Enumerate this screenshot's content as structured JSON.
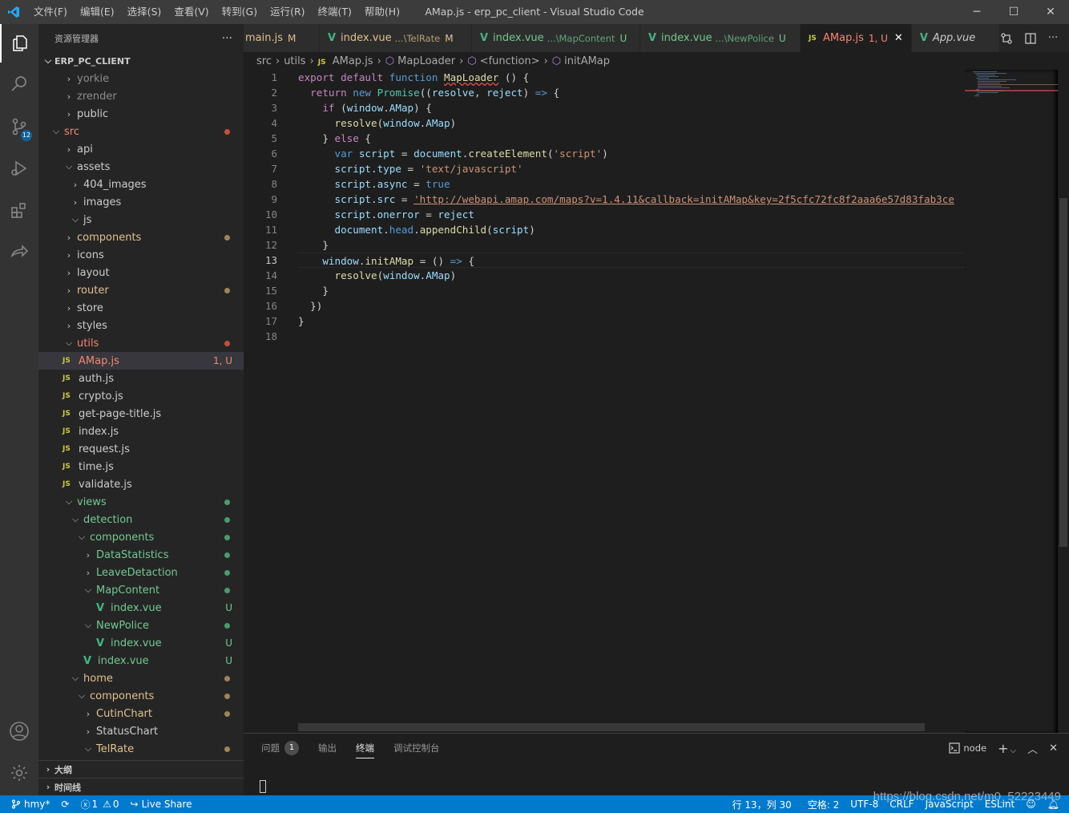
{
  "titlebar": {
    "menu": [
      "文件(F)",
      "编辑(E)",
      "选择(S)",
      "查看(V)",
      "转到(G)",
      "运行(R)",
      "终端(T)",
      "帮助(H)"
    ],
    "title": "AMap.js - erp_pc_client - Visual Studio Code",
    "minimize": "─",
    "maximize": "☐",
    "close": "✕"
  },
  "activity": {
    "scm_badge": "12"
  },
  "sidebar": {
    "title": "资源管理器",
    "more": "···",
    "root": "ERP_PC_CLIENT",
    "items": [
      {
        "label": "yorkie",
        "indent": 1,
        "type": "folder",
        "open": false,
        "color": "ignored"
      },
      {
        "label": "zrender",
        "indent": 1,
        "type": "folder",
        "open": false,
        "color": "ignored"
      },
      {
        "label": "public",
        "indent": 1,
        "type": "folder",
        "open": false,
        "color": "normal"
      },
      {
        "label": "src",
        "indent": 0,
        "type": "folder",
        "open": true,
        "color": "err",
        "dot": "err"
      },
      {
        "label": "api",
        "indent": 1,
        "type": "folder",
        "open": false,
        "color": "normal"
      },
      {
        "label": "assets",
        "indent": 1,
        "type": "folder",
        "open": true,
        "color": "normal"
      },
      {
        "label": "404_images",
        "indent": 2,
        "type": "folder",
        "open": false,
        "color": "normal"
      },
      {
        "label": "images",
        "indent": 2,
        "type": "folder",
        "open": false,
        "color": "normal"
      },
      {
        "label": "js",
        "indent": 2,
        "type": "folder",
        "open": true,
        "color": "normal"
      },
      {
        "label": "components",
        "indent": 1,
        "type": "folder",
        "open": false,
        "color": "mod",
        "dot": "mod"
      },
      {
        "label": "icons",
        "indent": 1,
        "type": "folder",
        "open": false,
        "color": "normal"
      },
      {
        "label": "layout",
        "indent": 1,
        "type": "folder",
        "open": false,
        "color": "normal"
      },
      {
        "label": "router",
        "indent": 1,
        "type": "folder",
        "open": false,
        "color": "mod",
        "dot": "mod"
      },
      {
        "label": "store",
        "indent": 1,
        "type": "folder",
        "open": false,
        "color": "normal"
      },
      {
        "label": "styles",
        "indent": 1,
        "type": "folder",
        "open": false,
        "color": "normal"
      },
      {
        "label": "utils",
        "indent": 1,
        "type": "folder",
        "open": true,
        "color": "err",
        "dot": "err"
      },
      {
        "label": "AMap.js",
        "indent": 1,
        "type": "js",
        "color": "err",
        "deco": "1, U",
        "selected": true
      },
      {
        "label": "auth.js",
        "indent": 1,
        "type": "js",
        "color": "normal"
      },
      {
        "label": "crypto.js",
        "indent": 1,
        "type": "js",
        "color": "normal"
      },
      {
        "label": "get-page-title.js",
        "indent": 1,
        "type": "js",
        "color": "normal"
      },
      {
        "label": "index.js",
        "indent": 1,
        "type": "js",
        "color": "normal"
      },
      {
        "label": "request.js",
        "indent": 1,
        "type": "js",
        "color": "normal"
      },
      {
        "label": "time.js",
        "indent": 1,
        "type": "js",
        "color": "normal"
      },
      {
        "label": "validate.js",
        "indent": 1,
        "type": "js",
        "color": "normal"
      },
      {
        "label": "views",
        "indent": 1,
        "type": "folder",
        "open": true,
        "color": "untracked",
        "dot": "untracked"
      },
      {
        "label": "detection",
        "indent": 2,
        "type": "folder",
        "open": true,
        "color": "untracked",
        "dot": "untracked"
      },
      {
        "label": "components",
        "indent": 3,
        "type": "folder",
        "open": true,
        "color": "untracked",
        "dot": "untracked"
      },
      {
        "label": "DataStatistics",
        "indent": 4,
        "type": "folder",
        "open": false,
        "color": "untracked",
        "dot": "untracked"
      },
      {
        "label": "LeaveDetaction",
        "indent": 4,
        "type": "folder",
        "open": false,
        "color": "untracked",
        "dot": "untracked"
      },
      {
        "label": "MapContent",
        "indent": 4,
        "type": "folder",
        "open": true,
        "color": "untracked",
        "dot": "untracked"
      },
      {
        "label": "index.vue",
        "indent": 5,
        "type": "vue",
        "color": "untracked",
        "deco": "U"
      },
      {
        "label": "NewPolice",
        "indent": 4,
        "type": "folder",
        "open": true,
        "color": "untracked",
        "dot": "untracked"
      },
      {
        "label": "index.vue",
        "indent": 5,
        "type": "vue",
        "color": "untracked",
        "deco": "U"
      },
      {
        "label": "index.vue",
        "indent": 3,
        "type": "vue",
        "color": "untracked",
        "deco": "U"
      },
      {
        "label": "home",
        "indent": 2,
        "type": "folder",
        "open": true,
        "color": "mod",
        "dot": "mod"
      },
      {
        "label": "components",
        "indent": 3,
        "type": "folder",
        "open": true,
        "color": "mod",
        "dot": "mod"
      },
      {
        "label": "CutinChart",
        "indent": 4,
        "type": "folder",
        "open": false,
        "color": "mod",
        "dot": "mod"
      },
      {
        "label": "StatusChart",
        "indent": 4,
        "type": "folder",
        "open": false,
        "color": "normal"
      },
      {
        "label": "TelRate",
        "indent": 4,
        "type": "folder",
        "open": true,
        "color": "mod",
        "dot": "mod"
      }
    ],
    "outline": "大纲",
    "timeline": "时间线"
  },
  "tabs": [
    {
      "label": "main.js",
      "desc": "",
      "status": "M",
      "icon": "none",
      "color": "mod"
    },
    {
      "label": "index.vue",
      "desc": "...\\TelRate",
      "status": "M",
      "icon": "vue",
      "color": "mod"
    },
    {
      "label": "index.vue",
      "desc": "...\\MapContent",
      "status": "U",
      "icon": "vue",
      "color": "untracked"
    },
    {
      "label": "index.vue",
      "desc": "...\\NewPolice",
      "status": "U",
      "icon": "vue",
      "color": "untracked"
    },
    {
      "label": "AMap.js",
      "desc": "",
      "status": "1, U",
      "icon": "js",
      "color": "err",
      "active": true,
      "close": "✕"
    },
    {
      "label": "App.vue",
      "desc": "",
      "status": "",
      "icon": "vue",
      "color": "normal",
      "italic": true
    }
  ],
  "tab_actions": {
    "more": "···"
  },
  "breadcrumb": [
    "src",
    "utils",
    "AMap.js",
    "MapLoader",
    "<function>",
    "initAMap"
  ],
  "editor": {
    "current_line": 13,
    "lines": [
      [
        [
          "kc",
          "export"
        ],
        [
          "t",
          " "
        ],
        [
          "kc",
          "default"
        ],
        [
          "t",
          " "
        ],
        [
          "kw",
          "function"
        ],
        [
          "t",
          " "
        ],
        [
          "fn",
          "MapLoader"
        ],
        [
          "t",
          " () {"
        ]
      ],
      [
        [
          "t",
          "  "
        ],
        [
          "kc",
          "return"
        ],
        [
          "t",
          " "
        ],
        [
          "kw",
          "new"
        ],
        [
          "t",
          " "
        ],
        [
          "cls",
          "Promise"
        ],
        [
          "t",
          "(("
        ],
        [
          "vr",
          "resolve"
        ],
        [
          "t",
          ", "
        ],
        [
          "vr",
          "reject"
        ],
        [
          "t",
          ") "
        ],
        [
          "kw",
          "=>"
        ],
        [
          "t",
          " {"
        ]
      ],
      [
        [
          "t",
          "    "
        ],
        [
          "kc",
          "if"
        ],
        [
          "t",
          " ("
        ],
        [
          "vr",
          "window"
        ],
        [
          "t",
          "."
        ],
        [
          "vr",
          "AMap"
        ],
        [
          "t",
          ") {"
        ]
      ],
      [
        [
          "t",
          "      "
        ],
        [
          "fn",
          "resolve"
        ],
        [
          "t",
          "("
        ],
        [
          "vr",
          "window"
        ],
        [
          "t",
          "."
        ],
        [
          "vr",
          "AMap"
        ],
        [
          "t",
          ")"
        ]
      ],
      [
        [
          "t",
          "    } "
        ],
        [
          "kc",
          "else"
        ],
        [
          "t",
          " {"
        ]
      ],
      [
        [
          "t",
          "      "
        ],
        [
          "kw",
          "var"
        ],
        [
          "t",
          " "
        ],
        [
          "vr",
          "script"
        ],
        [
          "t",
          " = "
        ],
        [
          "vr",
          "document"
        ],
        [
          "t",
          "."
        ],
        [
          "fn",
          "createElement"
        ],
        [
          "t",
          "("
        ],
        [
          "st",
          "'script'"
        ],
        [
          "t",
          ")"
        ]
      ],
      [
        [
          "t",
          "      "
        ],
        [
          "vr",
          "script"
        ],
        [
          "t",
          "."
        ],
        [
          "vr",
          "type"
        ],
        [
          "t",
          " = "
        ],
        [
          "st",
          "'text/javascript'"
        ]
      ],
      [
        [
          "t",
          "      "
        ],
        [
          "vr",
          "script"
        ],
        [
          "t",
          "."
        ],
        [
          "vr",
          "async"
        ],
        [
          "t",
          " = "
        ],
        [
          "kw",
          "true"
        ]
      ],
      [
        [
          "t",
          "      "
        ],
        [
          "vr",
          "script"
        ],
        [
          "t",
          "."
        ],
        [
          "vr",
          "src"
        ],
        [
          "t",
          " = "
        ],
        [
          "st",
          "'http://webapi.amap.com/maps?v=1.4.11&callback=initAMap&key=2f5cfc72fc8f2aaa6e57d83fab3ce"
        ]
      ],
      [
        [
          "t",
          "      "
        ],
        [
          "vr",
          "script"
        ],
        [
          "t",
          "."
        ],
        [
          "vr",
          "onerror"
        ],
        [
          "t",
          " = "
        ],
        [
          "vr",
          "reject"
        ]
      ],
      [
        [
          "t",
          "      "
        ],
        [
          "vr",
          "document"
        ],
        [
          "t",
          "."
        ],
        [
          "kw",
          "head"
        ],
        [
          "t",
          "."
        ],
        [
          "fn",
          "appendChild"
        ],
        [
          "t",
          "("
        ],
        [
          "vr",
          "script"
        ],
        [
          "t",
          ")"
        ]
      ],
      [
        [
          "t",
          "    }"
        ]
      ],
      [
        [
          "t",
          "    "
        ],
        [
          "vr",
          "window"
        ],
        [
          "t",
          "."
        ],
        [
          "fn",
          "initAMap"
        ],
        [
          "t",
          " = () "
        ],
        [
          "kw",
          "=>"
        ],
        [
          "t",
          " {"
        ]
      ],
      [
        [
          "t",
          "      "
        ],
        [
          "fn",
          "resolve"
        ],
        [
          "t",
          "("
        ],
        [
          "vr",
          "window"
        ],
        [
          "t",
          "."
        ],
        [
          "vr",
          "AMap"
        ],
        [
          "t",
          ")"
        ]
      ],
      [
        [
          "t",
          "    }"
        ]
      ],
      [
        [
          "t",
          "  })"
        ]
      ],
      [
        [
          "t",
          "}"
        ]
      ],
      [
        [
          "t",
          ""
        ]
      ]
    ]
  },
  "panel": {
    "tabs": [
      "问题",
      "输出",
      "终端",
      "调试控制台"
    ],
    "problems_count": "1",
    "terminal_select": "node",
    "add": "+"
  },
  "statusbar": {
    "branch": "hmy*",
    "errors": "1",
    "warnings": "0",
    "liveshare": "Live Share",
    "position": "行 13，列 30",
    "spaces": "空格: 2",
    "encoding": "UTF-8",
    "eol": "CRLF",
    "language": "JavaScript",
    "linter": "ESLint"
  },
  "watermark": "https://blog.csdn.net/m0_52223449"
}
